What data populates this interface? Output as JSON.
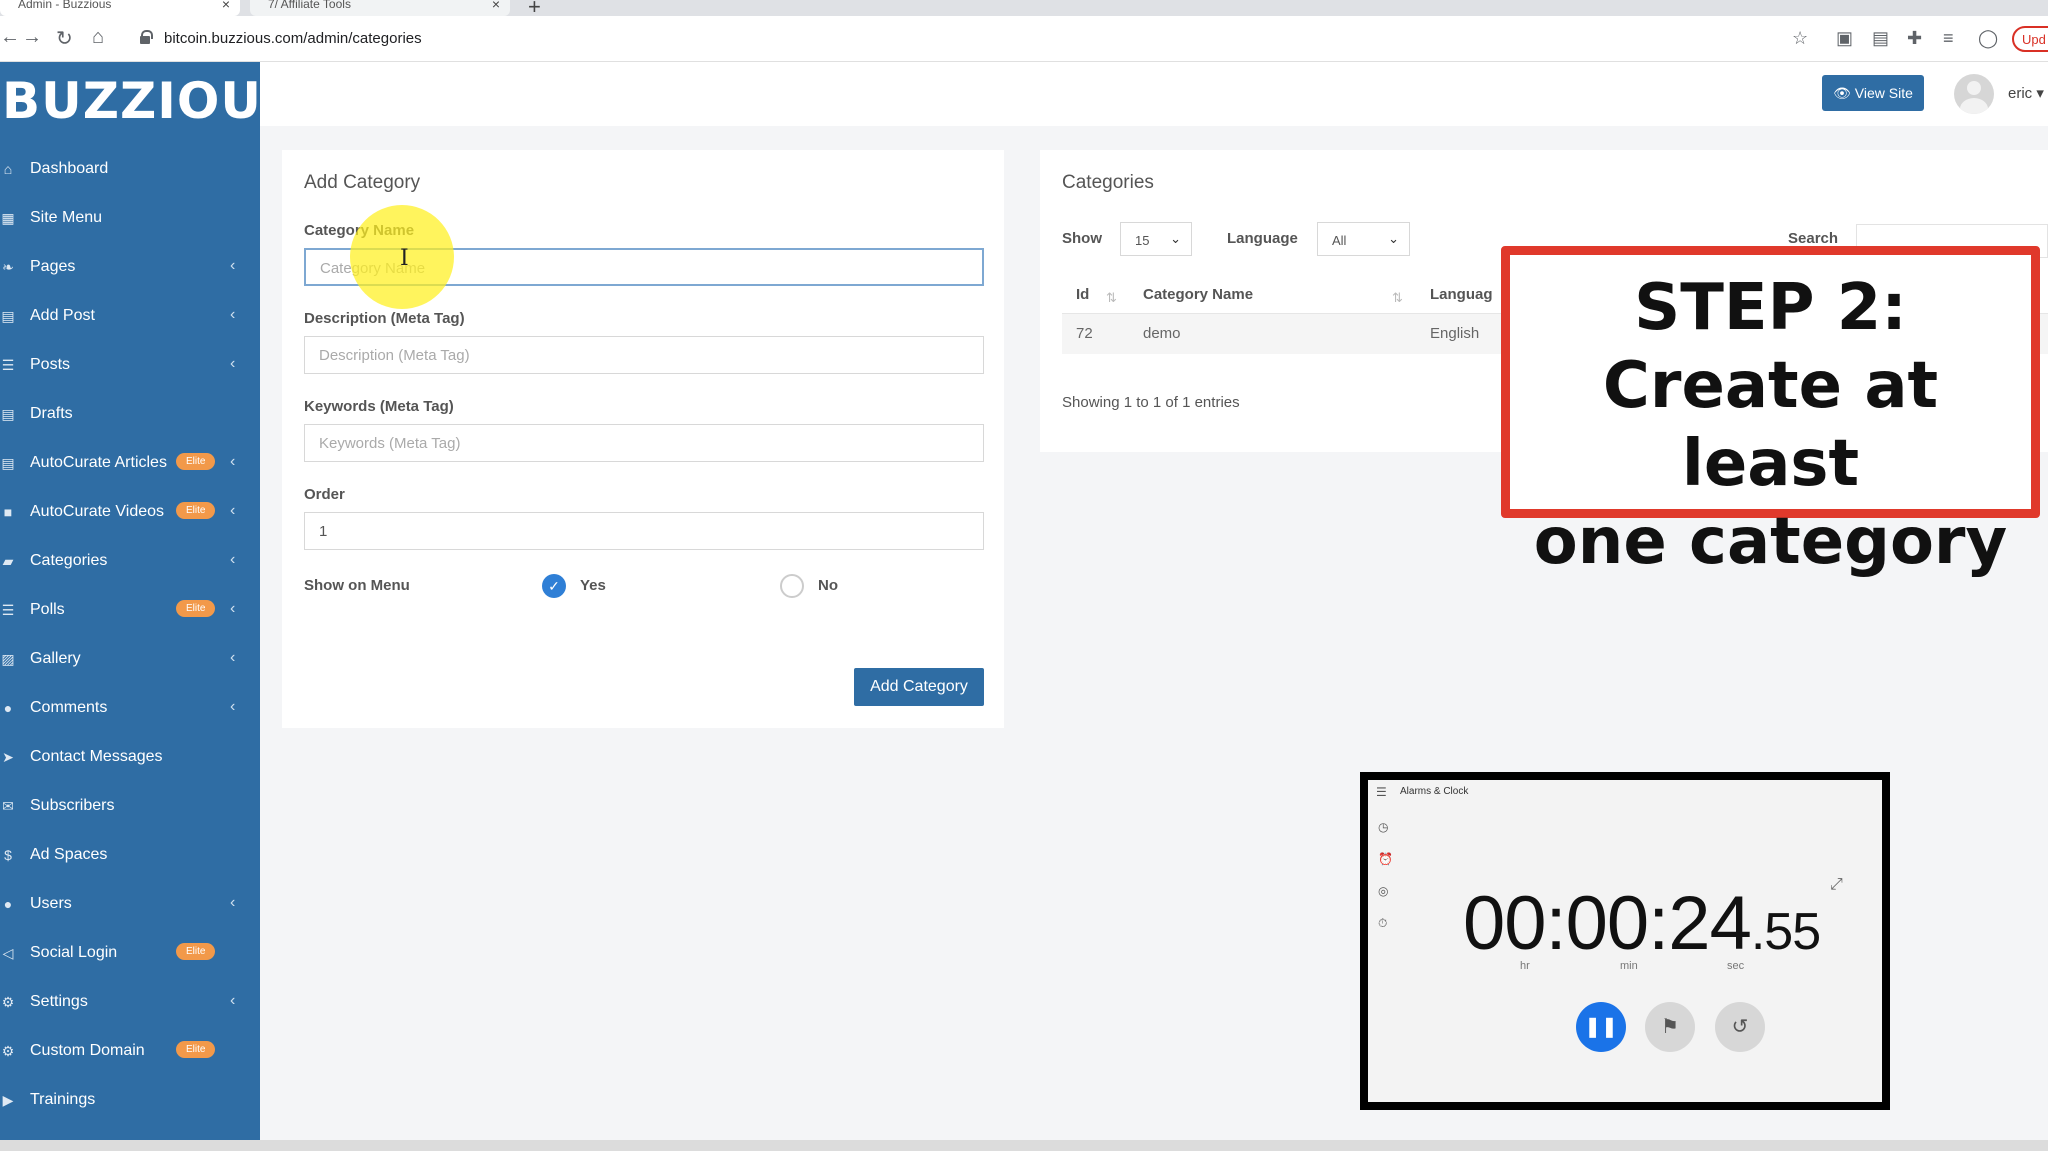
{
  "browser": {
    "tabs": [
      {
        "title": "Admin - Buzzious"
      },
      {
        "title": "7/ Affiliate Tools"
      }
    ],
    "url": "bitcoin.buzzious.com/admin/categories",
    "update_label": "Upd"
  },
  "brand": {
    "logo_text": "BUZZIOUS",
    "primary_color": "#2f6da4",
    "badge_color": "#f2994a",
    "accent_red": "#e0392b"
  },
  "sidebar": {
    "items": [
      {
        "label": "Dashboard",
        "icon": "home-icon",
        "badge": "",
        "chevron": false
      },
      {
        "label": "Site Menu",
        "icon": "grid-icon",
        "badge": "",
        "chevron": false
      },
      {
        "label": "Pages",
        "icon": "leaf-icon",
        "badge": "",
        "chevron": true
      },
      {
        "label": "Add Post",
        "icon": "file-icon",
        "badge": "",
        "chevron": true
      },
      {
        "label": "Posts",
        "icon": "list-icon",
        "badge": "",
        "chevron": true
      },
      {
        "label": "Drafts",
        "icon": "file-icon",
        "badge": "",
        "chevron": false
      },
      {
        "label": "AutoCurate Articles",
        "icon": "file-text-icon",
        "badge": "Elite",
        "chevron": true
      },
      {
        "label": "AutoCurate Videos",
        "icon": "video-icon",
        "badge": "Elite",
        "chevron": true
      },
      {
        "label": "Categories",
        "icon": "folder-icon",
        "badge": "",
        "chevron": true
      },
      {
        "label": "Polls",
        "icon": "list-icon",
        "badge": "Elite",
        "chevron": true
      },
      {
        "label": "Gallery",
        "icon": "image-icon",
        "badge": "",
        "chevron": true
      },
      {
        "label": "Comments",
        "icon": "comments-icon",
        "badge": "",
        "chevron": true
      },
      {
        "label": "Contact Messages",
        "icon": "paper-plane-icon",
        "badge": "",
        "chevron": false
      },
      {
        "label": "Subscribers",
        "icon": "envelope-icon",
        "badge": "",
        "chevron": false
      },
      {
        "label": "Ad Spaces",
        "icon": "dollar-icon",
        "badge": "",
        "chevron": false
      },
      {
        "label": "Users",
        "icon": "user-icon",
        "badge": "",
        "chevron": true
      },
      {
        "label": "Social Login",
        "icon": "share-icon",
        "badge": "Elite",
        "chevron": false
      },
      {
        "label": "Settings",
        "icon": "cogs-icon",
        "badge": "",
        "chevron": true
      },
      {
        "label": "Custom Domain",
        "icon": "gear-icon",
        "badge": "Elite",
        "chevron": false
      },
      {
        "label": "Trainings",
        "icon": "play-circle-icon",
        "badge": "",
        "chevron": false
      }
    ]
  },
  "header": {
    "view_site_label": "View Site",
    "username": "eric"
  },
  "add_category": {
    "title": "Add Category",
    "category_name_label": "Category Name",
    "category_name_placeholder": "Category Name",
    "description_label": "Description (Meta Tag)",
    "description_placeholder": "Description (Meta Tag)",
    "keywords_label": "Keywords (Meta Tag)",
    "keywords_placeholder": "Keywords (Meta Tag)",
    "order_label": "Order",
    "order_value": "1",
    "show_on_menu_label": "Show on Menu",
    "yes_label": "Yes",
    "no_label": "No",
    "show_on_menu_selected": "Yes",
    "submit_label": "Add Category"
  },
  "categories": {
    "title": "Categories",
    "show_label": "Show",
    "show_value": "15",
    "language_label": "Language",
    "language_value": "All",
    "search_label": "Search",
    "columns": [
      "Id",
      "Category Name",
      "Languag"
    ],
    "rows": [
      {
        "id": "72",
        "name": "demo",
        "language": "English"
      }
    ],
    "showing_text": "Showing 1 to 1 of 1 entries"
  },
  "step_overlay": {
    "line1": "STEP 2:",
    "line2": "Create at least",
    "line3": "one category"
  },
  "stopwatch": {
    "app_title": "Alarms & Clock",
    "time_main": "00:00:24",
    "time_fraction": ".55",
    "unit_hr": "hr",
    "unit_min": "min",
    "unit_sec": "sec"
  }
}
